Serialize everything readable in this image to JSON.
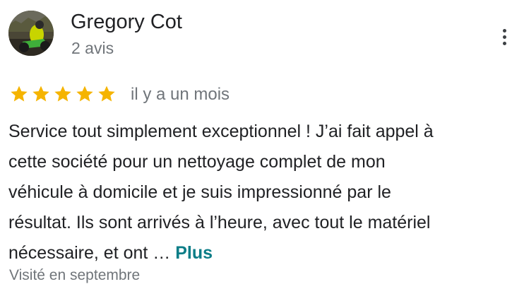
{
  "reviewer": {
    "name": "Gregory Cot",
    "review_count": "2 avis"
  },
  "review": {
    "stars": 5,
    "star_color": "#f5b400",
    "date": "il y a un mois",
    "text_lines": [
      "Service tout simplement exceptionnel ! J’ai fait appel à",
      "cette société pour un nettoyage complet de mon",
      "véhicule à domicile et je suis impressionné par le",
      "résultat. Ils sont arrivés à l’heure, avec tout le matériel",
      "nécessaire, et ont … "
    ],
    "more_label": "Plus",
    "more_color": "#0b7d87",
    "visit_info": "Visité en septembre"
  },
  "icons": {
    "menu": "more-vert-icon",
    "star": "star-icon"
  }
}
